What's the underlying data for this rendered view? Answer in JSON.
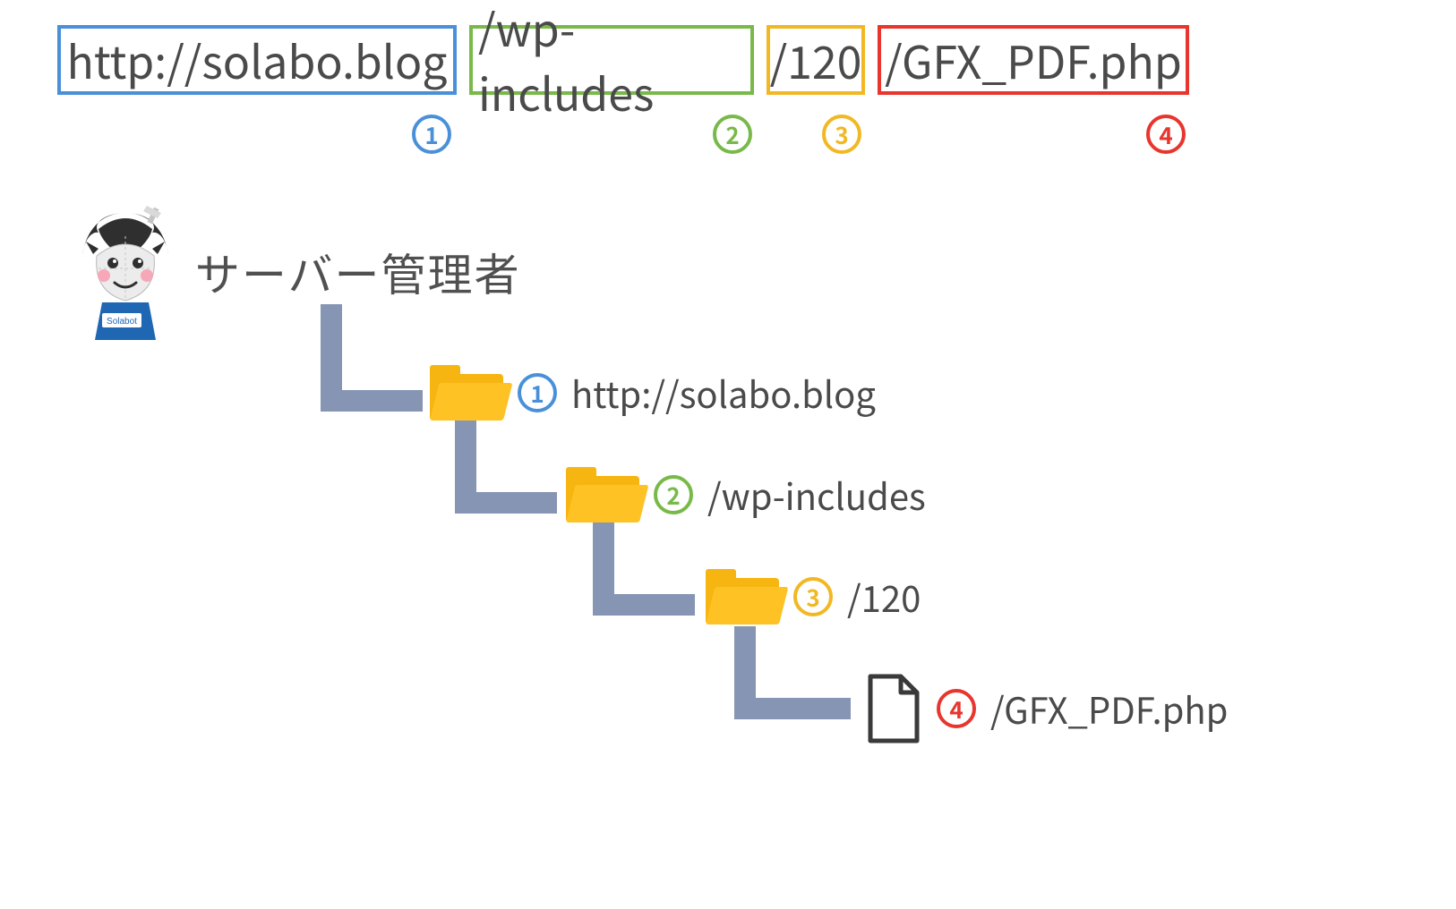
{
  "url_segments": [
    {
      "num": "1",
      "text": "http://solabo.blog",
      "color": "#4a90d9"
    },
    {
      "num": "2",
      "text": "/wp-includes",
      "color": "#79b94a"
    },
    {
      "num": "3",
      "text": "/120",
      "color": "#f2b824"
    },
    {
      "num": "4",
      "text": "/GFX_PDF.php",
      "color": "#e8352e"
    }
  ],
  "admin_title": "サーバー管理者",
  "avatar_shirt_label": "Solabot",
  "tree": [
    {
      "num": "1",
      "label": "http://solabo.blog",
      "icon": "folder"
    },
    {
      "num": "2",
      "label": "/wp-includes",
      "icon": "folder"
    },
    {
      "num": "3",
      "label": "/120",
      "icon": "folder"
    },
    {
      "num": "4",
      "label": "/GFX_PDF.php",
      "icon": "file"
    }
  ]
}
